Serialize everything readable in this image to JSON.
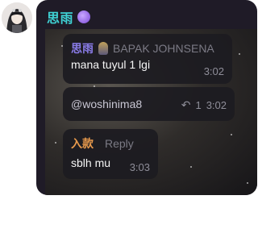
{
  "sender": {
    "name": "思雨"
  },
  "messages": [
    {
      "author": "思雨",
      "reply_to": "BAPAK JOHNSENA",
      "text": "mana tuyul 1 lgi",
      "time": "3:02"
    },
    {
      "text": "@woshinima8",
      "reply_count": "1",
      "time": "3:02"
    },
    {
      "author": "入款",
      "action": "Reply",
      "text": "sblh mu",
      "time": "3:03"
    }
  ],
  "colors": {
    "sender": "#3fd2d5",
    "author_1": "#8b7dea",
    "author_3": "#e89a4c",
    "bubble_bg": "#1f1b27",
    "meta": "#8f8e99"
  },
  "icons": [
    "avatar-girl",
    "purple-badge-icon",
    "reply-arrow-icon"
  ]
}
